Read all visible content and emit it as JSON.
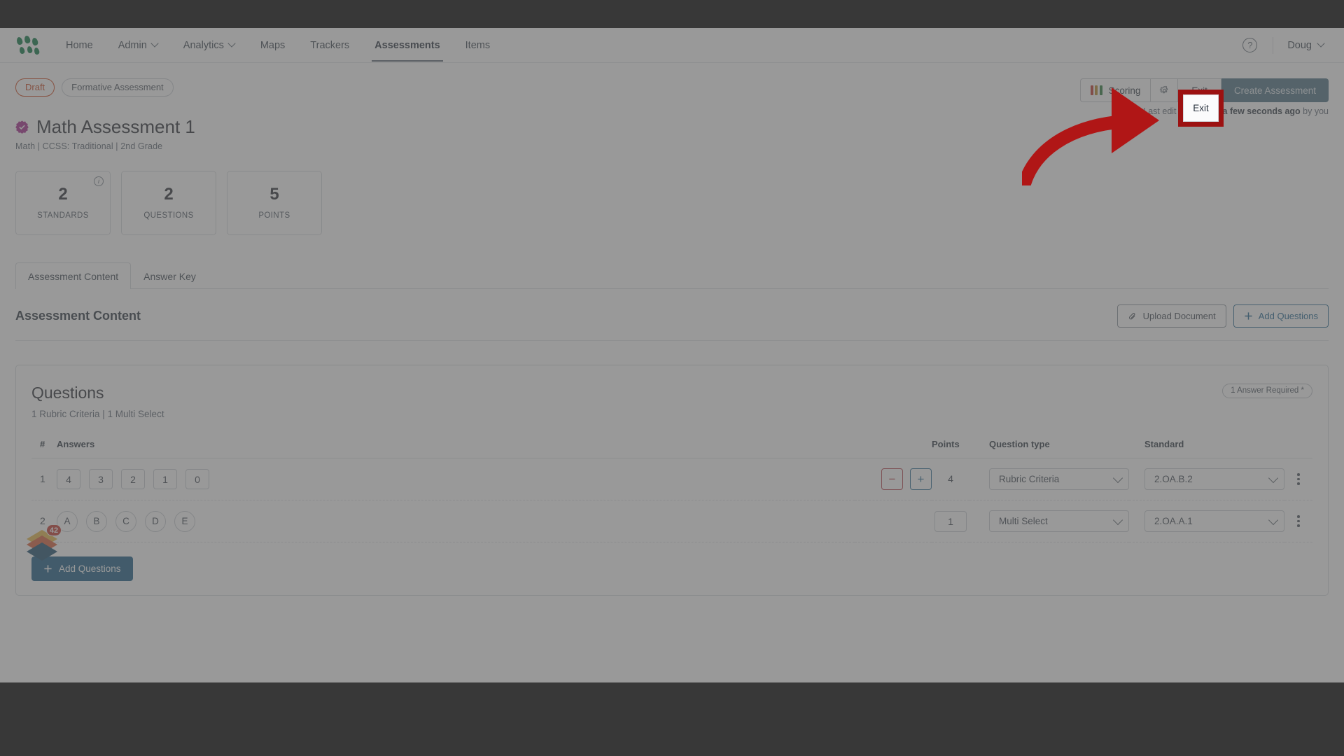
{
  "nav": {
    "logo_icon": "dots-leaf-logo",
    "links": [
      {
        "label": "Home",
        "caret": false,
        "active": false
      },
      {
        "label": "Admin",
        "caret": true,
        "active": false
      },
      {
        "label": "Analytics",
        "caret": true,
        "active": false
      },
      {
        "label": "Maps",
        "caret": false,
        "active": false
      },
      {
        "label": "Trackers",
        "caret": false,
        "active": false
      },
      {
        "label": "Assessments",
        "caret": false,
        "active": true
      },
      {
        "label": "Items",
        "caret": false,
        "active": false
      }
    ],
    "help_icon": "question-circle-icon",
    "help_glyph": "?",
    "user_name": "Doug"
  },
  "header": {
    "status_pill": "Draft",
    "type_pill": "Formative Assessment",
    "verified_icon": "verified-badge-icon",
    "verified_color": "#a62a8e",
    "title": "Math Assessment 1",
    "subtitle": "Math  |  CCSS: Traditional  |  2nd Grade",
    "actions": {
      "scoring_label": "Scoring",
      "scoring_icon": "score-bars-icon",
      "scoring_bar_colors": [
        "#c0392b",
        "#b9892a",
        "#2f7d3e"
      ],
      "gear_icon": "gear-icon",
      "exit_label": "Exit",
      "create_label": "Create Assessment"
    },
    "saved_note_prefix": "Last edit was saved ",
    "saved_note_strong": "a few seconds ago",
    "saved_note_suffix": " by you"
  },
  "stats": [
    {
      "value": "2",
      "label": "STANDARDS",
      "info_icon": "info-circle-icon",
      "info_glyph": "i"
    },
    {
      "value": "2",
      "label": "QUESTIONS"
    },
    {
      "value": "5",
      "label": "POINTS"
    }
  ],
  "tabs": [
    {
      "label": "Assessment Content",
      "active": true
    },
    {
      "label": "Answer Key",
      "active": false
    }
  ],
  "section": {
    "title": "Assessment Content",
    "upload_label": "Upload Document",
    "upload_icon": "paperclip-icon",
    "add_questions_label": "Add Questions",
    "add_questions_icon": "plus-icon"
  },
  "questions_panel": {
    "title": "Questions",
    "subtitle": "1 Rubric Criteria | 1 Multi Select",
    "required_pill": "1 Answer Required *",
    "columns": [
      "#",
      "Answers",
      "",
      "Points",
      "Question type",
      "Standard",
      ""
    ],
    "rows": [
      {
        "num": "1",
        "answer_style": "box",
        "answers": [
          "4",
          "3",
          "2",
          "1",
          "0"
        ],
        "stepper": {
          "minus": "−",
          "plus": "+",
          "minus_color": "#b6424b",
          "plus_color": "#2b6d93"
        },
        "points_display": "4",
        "points_editable": false,
        "question_type": "Rubric Criteria",
        "standard": "2.OA.B.2",
        "kebab_icon": "kebab-menu-icon"
      },
      {
        "num": "2",
        "answer_style": "circle",
        "answers": [
          "A",
          "B",
          "C",
          "D",
          "E"
        ],
        "points_display": "1",
        "points_editable": true,
        "question_type": "Multi Select",
        "standard": "2.OA.A.1",
        "kebab_icon": "kebab-menu-icon"
      }
    ],
    "add_questions_label": "Add Questions",
    "add_questions_icon": "plus-icon"
  },
  "fab": {
    "icon": "stacked-diamonds-icon",
    "badge_count": "42",
    "badge_color": "#c6392f"
  },
  "annotation": {
    "highlight_target": "exit-button",
    "highlight_color": "#9c1111",
    "arrow_icon": "curved-arrow-icon",
    "exit_label": "Exit"
  }
}
